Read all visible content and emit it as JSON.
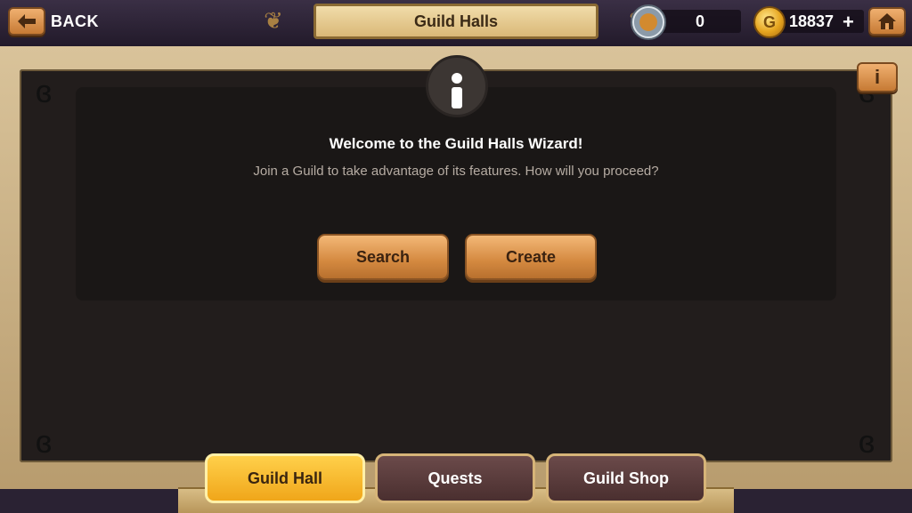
{
  "header": {
    "back_label": "BACK",
    "title": "Guild Halls",
    "rank_value": "0",
    "gold_value": "18837",
    "plus_label": "+"
  },
  "wizard": {
    "title": "Welcome to the Guild Halls Wizard!",
    "description": "Join a Guild to take advantage of its features. How will you proceed?",
    "search_label": "Search",
    "create_label": "Create"
  },
  "tabs": [
    {
      "label": "Guild Hall",
      "active": true
    },
    {
      "label": "Quests",
      "active": false
    },
    {
      "label": "Guild Shop",
      "active": false
    }
  ],
  "icons": {
    "back": "back-arrow-icon",
    "home": "home-icon",
    "info": "info-icon",
    "rank": "rank-medal-icon",
    "gold": "gold-coin-icon"
  },
  "colors": {
    "accent": "#d48940",
    "active_tab": "#f0a61a",
    "frame": "#d9c39a"
  }
}
